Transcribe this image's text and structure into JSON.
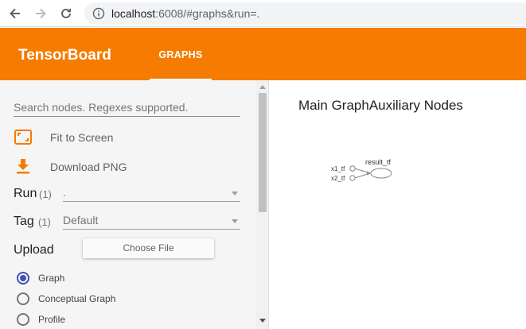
{
  "browser": {
    "url_host": "localhost",
    "url_rest": ":6008/#graphs&run=."
  },
  "header": {
    "brand": "TensorBoard",
    "tab_graphs": "GRAPHS"
  },
  "sidebar": {
    "search_placeholder": "Search nodes. Regexes supported.",
    "fit_to_screen": "Fit to Screen",
    "download_png": "Download PNG",
    "run": {
      "label": "Run",
      "count": "(1)",
      "value": "."
    },
    "tag": {
      "label": "Tag",
      "count": "(1)",
      "value": "Default"
    },
    "upload": {
      "label": "Upload",
      "button": "Choose File"
    },
    "radios": [
      {
        "label": "Graph",
        "selected": true
      },
      {
        "label": "Conceptual Graph",
        "selected": false
      },
      {
        "label": "Profile",
        "selected": false
      }
    ]
  },
  "main": {
    "title": "Main GraphAuxiliary Nodes",
    "graph": {
      "nodes": [
        "x1_tf",
        "x2_tf",
        "result_tf"
      ]
    }
  },
  "colors": {
    "header": "#f57c00",
    "accent_radio": "#3f51b5",
    "icon_orange": "#f57c00"
  }
}
